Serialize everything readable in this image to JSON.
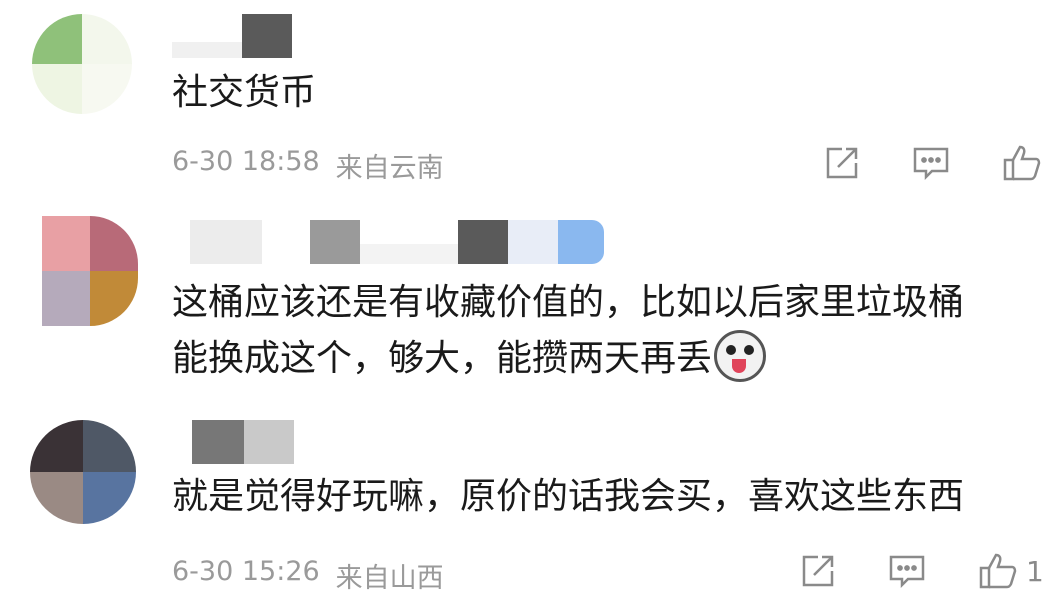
{
  "comments": [
    {
      "text": "社交货币",
      "time": "6-30 18:58",
      "location": "来自云南",
      "avatar_colors": [
        "#8fc17a",
        "#f3f7ec",
        "#eef5e3",
        "#f7f9f1"
      ],
      "name_colors": [
        "#f0f0f0",
        "#5a5a5a"
      ],
      "like_count": ""
    },
    {
      "text_line1": "这桶应该还是有收藏价值的，比如以后家里垃圾桶",
      "text_line2": "能换成这个，够大，能攒两天再丢",
      "avatar_colors": [
        "#e8a0a4",
        "#b86a78",
        "#b5aabb",
        "#c18a38"
      ],
      "name_colors": [
        "#ececec",
        "#9a9a9a",
        "#f3f3f3",
        "#5a5a5a",
        "#e8edf7",
        "#8ab8ef"
      ],
      "emoji": "dog-face-emoji"
    },
    {
      "text": "就是觉得好玩嘛，原价的话我会买，喜欢这些东西",
      "time": "6-30 15:26",
      "location": "来自山西",
      "avatar_colors": [
        "#3a3236",
        "#4f5866",
        "#9a8a84",
        "#5874a0"
      ],
      "name_colors": [
        "#777777",
        "#c9c9c9"
      ],
      "like_count": "1"
    }
  ],
  "icons": {
    "share": "share-icon",
    "comment": "comment-icon",
    "like": "thumbs-up-icon"
  }
}
